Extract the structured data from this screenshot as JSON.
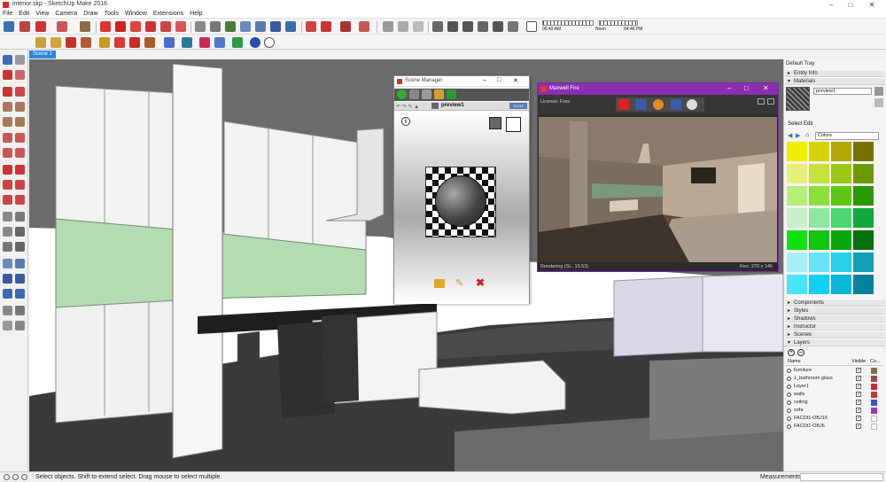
{
  "window": {
    "title": "interior.skp - SketchUp Make 2016"
  },
  "menu": [
    "File",
    "Edit",
    "View",
    "Camera",
    "Draw",
    "Tools",
    "Window",
    "Extensions",
    "Help"
  ],
  "scene_tab": "Scene 1",
  "status": {
    "hint": "Select objects. Shift to extend select. Drag mouse to select multiple.",
    "measurements_label": "Measurements"
  },
  "shadow_bar": {
    "time1": "06:43 AM",
    "noon": "Noon",
    "time2": "04:46 PM"
  },
  "tray": {
    "title": "Default Tray",
    "sections_top": [
      "Entity Info",
      "Materials"
    ],
    "material_name": "preview1",
    "tabs": [
      "Select",
      "Edit"
    ],
    "library": "Colors",
    "sections_bottom": [
      "Components",
      "Styles",
      "Shadows",
      "Instructor",
      "Scenes",
      "Layers"
    ],
    "layer_headers": {
      "name": "Name",
      "visible": "Visible",
      "color": "Co..."
    },
    "layers": [
      {
        "name": "furniture",
        "color": "#8a6d4a"
      },
      {
        "name": "1_bathroom glass",
        "color": "#9a4a4a"
      },
      {
        "name": "Layer1",
        "color": "#d0283a"
      },
      {
        "name": "walls",
        "color": "#c8392a"
      },
      {
        "name": "ceiling",
        "color": "#3a54c8"
      },
      {
        "name": "sofa",
        "color": "#a23ab8"
      },
      {
        "name": "FACDt1-OBJ16",
        "color": "#ffffff"
      },
      {
        "name": "FACDt1-OBJ6",
        "color": "#ffffff"
      }
    ],
    "swatches": [
      "#f2ee00",
      "#d8d200",
      "#b0a800",
      "#7a7200",
      "#e4f078",
      "#c8e03c",
      "#9cc814",
      "#6c9a00",
      "#b4f078",
      "#8ce03c",
      "#5cc814",
      "#2a9a00",
      "#c8f0c8",
      "#8ce89c",
      "#4cd870",
      "#10a83c",
      "#10e010",
      "#10c810",
      "#0aa80a",
      "#087008",
      "#a8f0f8",
      "#64e4f4",
      "#28d0e8",
      "#10a0b8",
      "#48e4f8",
      "#10d0f0",
      "#08b8d8",
      "#0880a0"
    ]
  },
  "scene_manager": {
    "title": "Scene Manager",
    "preview_label": "preview1",
    "badge": "SOOS"
  },
  "maxwell": {
    "title": "Maxwell Fire",
    "license": "License: Free",
    "status": "Rendering (SL: 10.53)",
    "res": "Res: 270 x 146"
  }
}
